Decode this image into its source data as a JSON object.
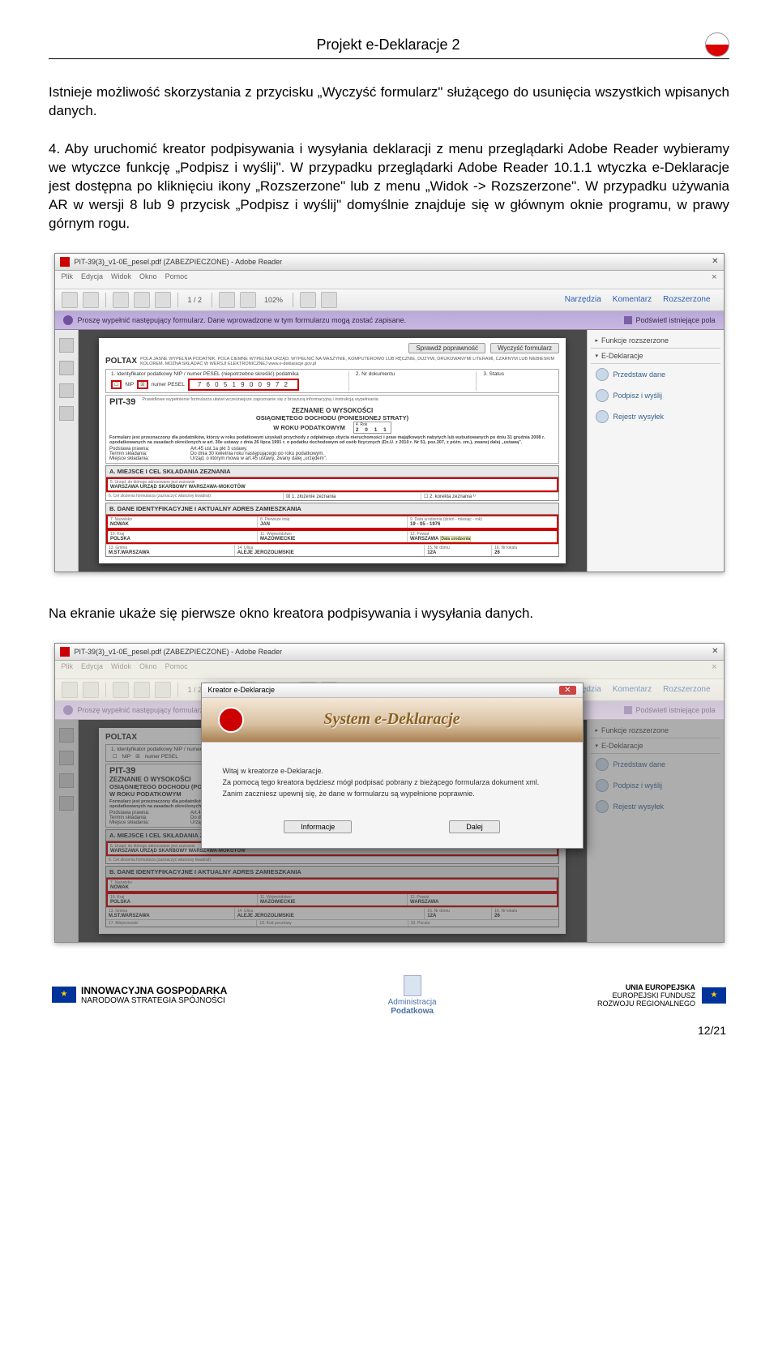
{
  "header": {
    "title": "Projekt e-Deklaracje 2"
  },
  "para1": "Istnieje możliwość skorzystania z przycisku „Wyczyść formularz\" służącego do usunięcia wszystkich wpisanych danych.",
  "para2": "4. Aby uruchomić kreator podpisywania i wysyłania deklaracji z menu przeglądarki Adobe Reader wybieramy we wtyczce funkcję „Podpisz i wyślij\". W przypadku przeglądarki Adobe Reader 10.1.1 wtyczka e-Deklaracje jest dostępna po kliknięciu ikony „Rozszerzone\" lub z menu „Widok -> Rozszerzone\".  W przypadku używania AR w wersji 8 lub 9 przycisk „Podpisz i wyślij\" domyślnie znajduje się w głównym oknie programu, w prawy górnym rogu.",
  "para3": "Na ekranie ukaże się pierwsze okno kreatora podpisywania i wysyłania danych.",
  "reader": {
    "title": "PIT-39(3)_v1-0E_pesel.pdf (ZABEZPIECZONE) - Adobe Reader",
    "menu": [
      "Plik",
      "Edycja",
      "Widok",
      "Okno",
      "Pomoc"
    ],
    "page": "1 / 2",
    "zoom": "102%",
    "links": {
      "narzedzia": "Narzędzia",
      "komentarz": "Komentarz",
      "rozszerzone": "Rozszerzone"
    },
    "purpleText": "Proszę wypełnić następujący formularz. Dane wprowadzone w tym formularzu mogą zostać zapisane.",
    "highlightFields": "Podświetl istniejące pola",
    "sidebar": {
      "funkc": "Funkcje rozszerzone",
      "eDekl": "E-Deklaracje",
      "i1": "Przedstaw dane",
      "i2": "Podpisz i wyślij",
      "i3": "Rejestr wysyłek"
    },
    "form": {
      "btnCheck": "Sprawdź poprawność",
      "btnClear": "Wyczyść formularz",
      "poltax": "POLTAX",
      "poltaxDesc": "POLA JASNE WYPEŁNIA PODATNIK, POLA CIEMNE WYPEŁNIA URZĄD. WYPEŁNIĆ NA MASZYNIE, KOMPUTEROWO LUB RĘCZNIE, DUŻYMI, DRUKOWANYMI LITERAMI, CZARNYM LUB NIEBIESKIM KOLOREM.   MOŻNA SKŁADAĆ W WERSJI ELEKTRONICZNEJ www.e-deklaracje.gov.pl",
      "h1lbl": "1. Identyfikator podatkowy NIP / numer PESEL (niepotrzebne skreślić) podatnika",
      "h2lbl": "2. Nr dokumentu",
      "h3lbl": "3. Status",
      "nipLbl": "NIP",
      "peselLbl": "numer PESEL",
      "peselGrid": "7 6 0 5 1 9 0 0 9 7 2",
      "pitNum": "PIT-39",
      "pitTxt": "Prawidłowe wypełnienie formularza ułatwi wcześniejsze zapoznanie się z broszurą informacyjną i instrukcją wypełniania",
      "pitSub": "ZEZNANIE O WYSOKOŚCI",
      "pitSub2": "OSIĄGNIĘTEGO DOCHODU (PONIESIONEJ STRATY)",
      "yearLbl": "W ROKU PODATKOWYM",
      "yearNum": "4. Rok",
      "year": "2 0 1 1",
      "desc": "Formularz jest przeznaczony dla podatników, którzy w roku podatkowym uzyskali przychody z odpłatnego zbycia nieruchomości i praw majątkowych nabytych lub wybudowanych po dniu 31 grudnia 2008 r. opodatkowanych na zasadach określonych w art. 30e ustawy z dnia 26 lipca 1991 r. o podatku dochodowym od osób fizycznych (Dz.U. z 2010 r. Nr 51, poz.307, z późn. zm.), zwanej dalej „ustawą\".",
      "row_pp_l": "Podstawa prawna:",
      "row_pp_v": "Art.45 ust.1a pkt 3 ustawy.",
      "row_ts_l": "Termin składania:",
      "row_ts_v": "Do dnia 30 kwietnia roku następującego po roku podatkowym.",
      "row_ms_l": "Miejsce składania:",
      "row_ms_v": "Urząd, o którym mowa w art.45 ustawy, zwany dalej „urzędem\".",
      "secA": "A. MIEJSCE I CEL SKŁADANIA ZEZNANIA",
      "a5": "5. Urząd, do którego adresowane jest zeznanie",
      "a5v": "WARSZAWA            URZĄD SKARBOWY WARSZAWA-MOKOTÓW",
      "a6": "6. Cel złożenia formularza (zaznaczyć właściwy kwadrat):",
      "a6a": "1. złożenie zeznania",
      "a6b": "2. korekta zeznania ¹⁾",
      "secB": "B. DANE IDENTYFIKACYJNE I AKTUALNY ADRES ZAMIESZKANIA",
      "b7": "7. Nazwisko",
      "b7v": "NOWAK",
      "b8": "8. Pierwsze imię",
      "b8v": "JAN",
      "b9": "9. Data urodzenia (dzień - miesiąc - rok)",
      "b9v": "19 - 05 - 1976",
      "b10": "10. Kraj",
      "b10v": "POLSKA",
      "b11": "11. Województwo",
      "b11v": "MAZOWIECKIE",
      "b12": "12. Powiat",
      "b12v": "WARSZAWA",
      "b12w": "Data urodzenia",
      "b13": "13. Gmina",
      "b13v": "M.ST.WARSZAWA",
      "b14": "14. Ulica",
      "b14v": "ALEJE JEROZOLIMSKIE",
      "b15": "15. Nr domu",
      "b15v": "12A",
      "b16": "16. Nr lokalu",
      "b16v": "26",
      "b17": "17. Miejscowość",
      "b18": "18. Kod pocztowy",
      "b19": "19. Poczta"
    }
  },
  "wizard": {
    "title": "Kreator e-Deklaracje",
    "banner": "System e-Deklaracje",
    "l1": "Witaj w kreatorze e-Deklaracje.",
    "l2": "Za pomocą tego kreatora będziesz mógł podpisać pobrany z bieżącego formularza dokument xml.",
    "l3": "Zanim zaczniesz upewnij się, że dane w formularzu są wypełnione poprawnie.",
    "btnInfo": "Informacje",
    "btnNext": "Dalej"
  },
  "footer": {
    "left1": "INNOWACYJNA GOSPODARKA",
    "left2": "NARODOWA STRATEGIA SPÓJNOŚCI",
    "center1": "Administracja",
    "center2": "Podatkowa",
    "right1": "UNIA EUROPEJSKA",
    "right2": "EUROPEJSKI FUNDUSZ",
    "right3": "ROZWOJU REGIONALNEGO",
    "pagenum": "12/21"
  }
}
